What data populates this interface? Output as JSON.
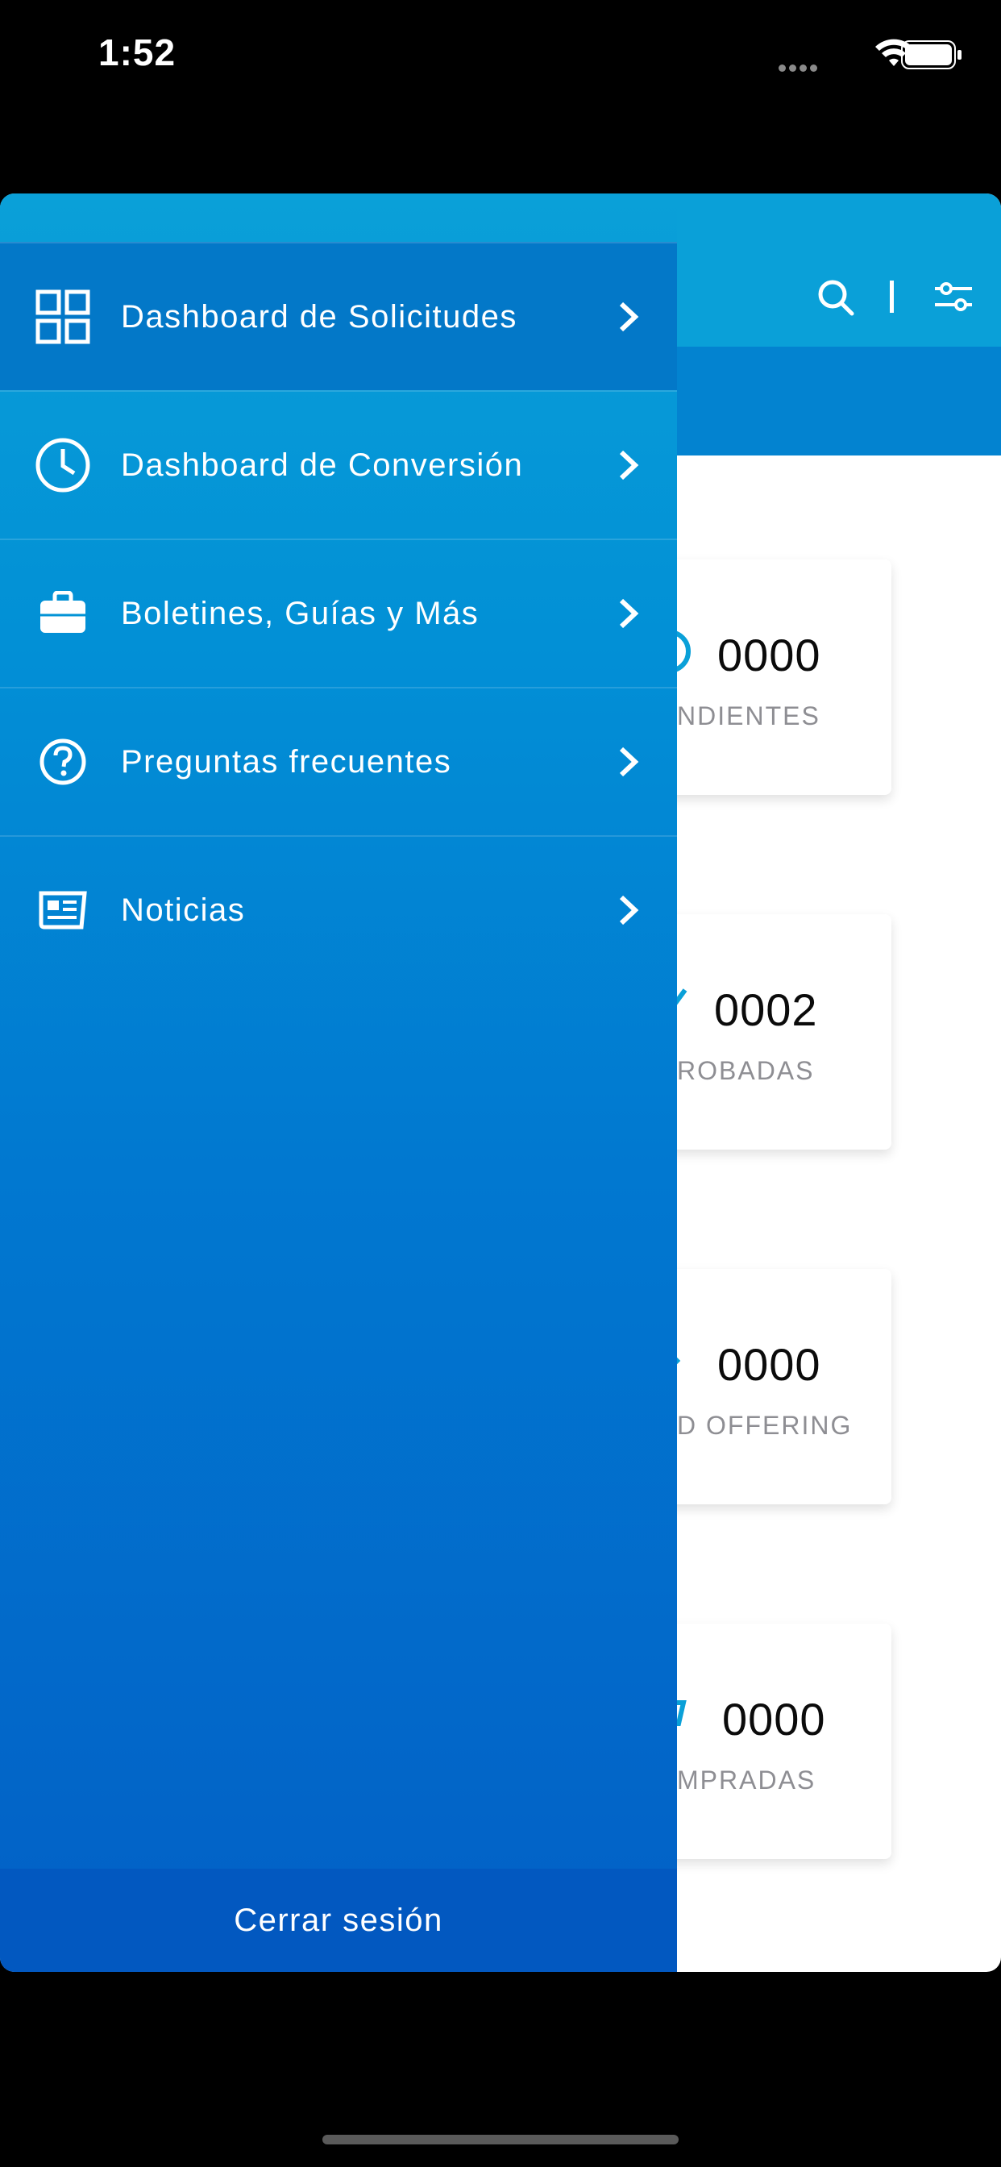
{
  "status_bar": {
    "time": "1:52"
  },
  "menu": {
    "items": [
      {
        "label": "Dashboard de Solicitudes",
        "icon": "grid-icon"
      },
      {
        "label": "Dashboard de Conversión",
        "icon": "clock-icon"
      },
      {
        "label": "Boletines, Guías y Más",
        "icon": "briefcase-icon"
      },
      {
        "label": "Preguntas frecuentes",
        "icon": "question-circle-icon"
      },
      {
        "label": "Noticias",
        "icon": "newspaper-icon"
      }
    ],
    "logout_label": "Cerrar sesión"
  },
  "background": {
    "cards": [
      {
        "value": "0000",
        "label": "NDIENTES"
      },
      {
        "value": "0002",
        "label": "ROBADAS"
      },
      {
        "value": "0000",
        "label": "D OFFERING"
      },
      {
        "value": "0000",
        "label": "MPRADAS"
      }
    ]
  },
  "colors": {
    "drawer_top": "#0aa0d8",
    "drawer_bottom": "#0260c6",
    "accent": "#0aa0d8"
  }
}
